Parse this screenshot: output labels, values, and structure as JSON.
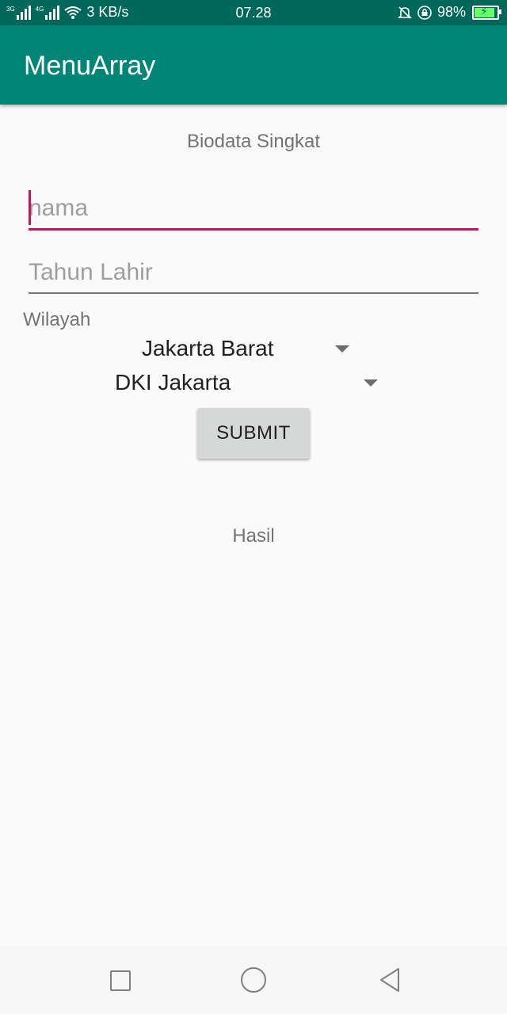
{
  "status_bar": {
    "net1": "3G",
    "net2": "4G",
    "speed": "3 KB/s",
    "time": "07.28",
    "battery": "98%",
    "battery_level": 0.98,
    "icons": [
      "signal-icon",
      "wifi-icon",
      "mute-icon",
      "rotation-lock-icon",
      "battery-icon"
    ]
  },
  "app_bar": {
    "title": "MenuArray",
    "color": "#008577"
  },
  "form": {
    "heading": "Biodata Singkat",
    "nama": {
      "placeholder": "nama",
      "value": ""
    },
    "tahun_lahir": {
      "placeholder": "Tahun Lahir",
      "value": ""
    },
    "wilayah_label": "Wilayah",
    "kota_spinner": {
      "selected": "Jakarta Barat"
    },
    "provinsi_spinner": {
      "selected": "DKI Jakarta"
    },
    "submit_label": "SUBMIT",
    "result_label": "Hasil",
    "accent_color": "#c2185b"
  },
  "nav_bar": {
    "icons": [
      "recent-apps-icon",
      "home-icon",
      "back-icon"
    ]
  }
}
